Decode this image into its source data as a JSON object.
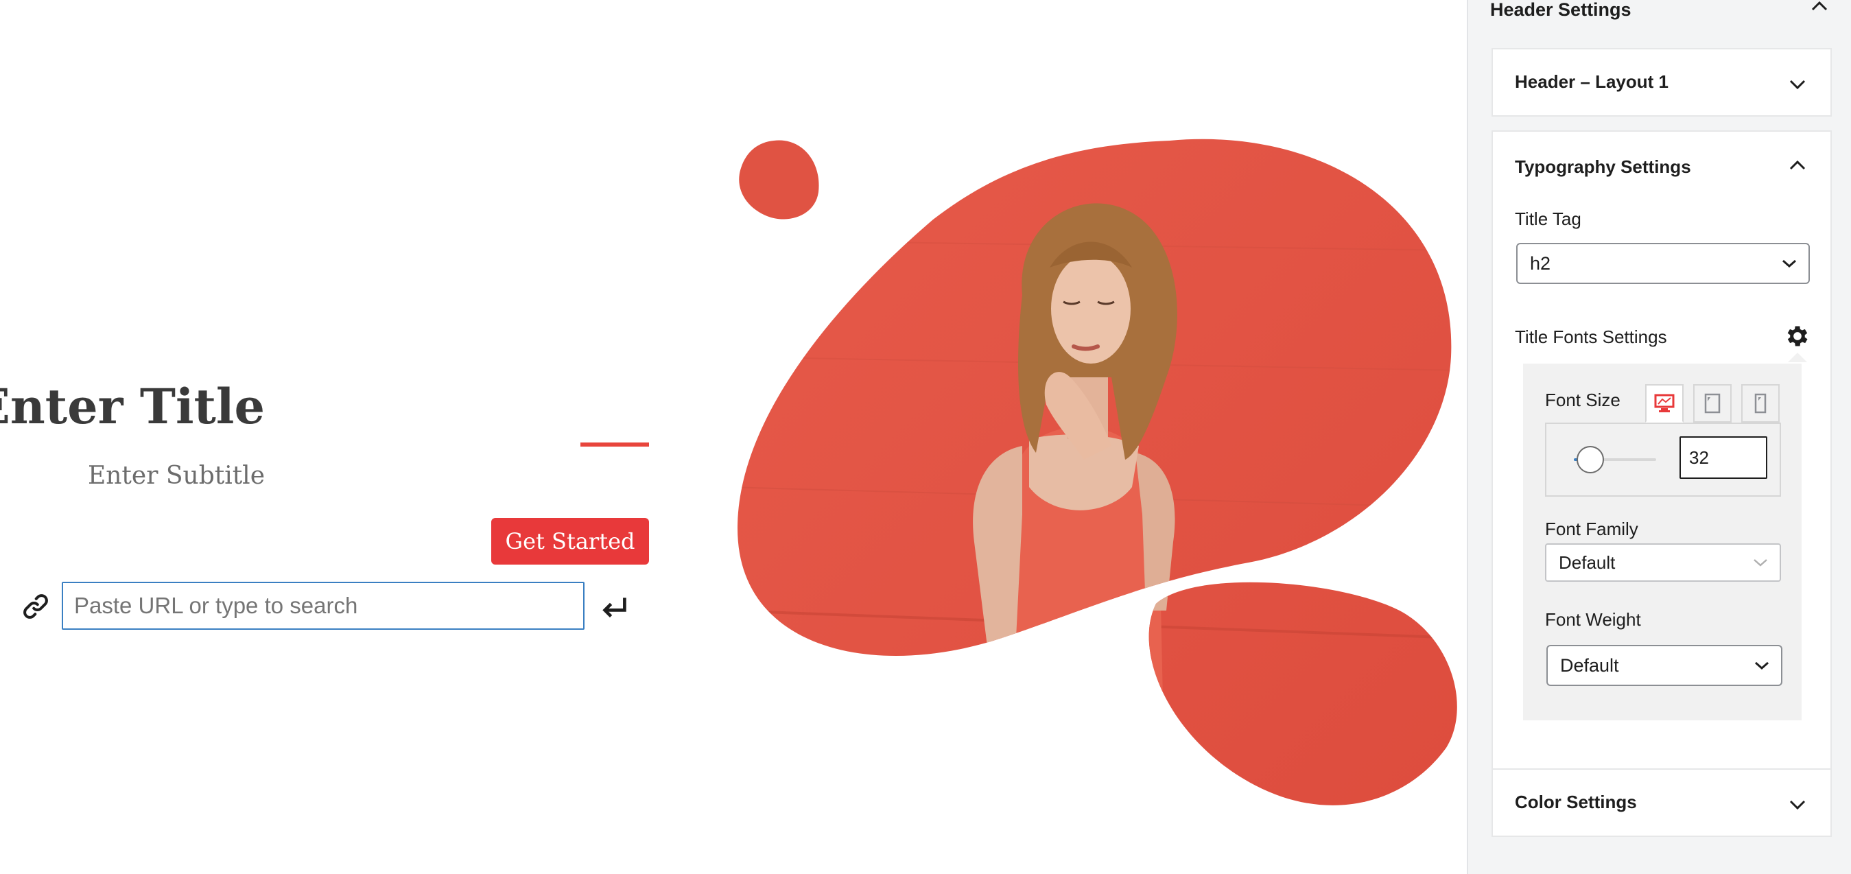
{
  "canvas": {
    "hero": {
      "title": "Enter Title",
      "subtitle": "Enter Subtitle",
      "button_label": "Get Started"
    },
    "link_popover": {
      "placeholder": "Paste URL or type to search",
      "icon": "link-icon",
      "submit_icon": "enter-return-icon"
    },
    "colors": {
      "accent": "#e8453c",
      "button": "#e8393a",
      "blob": "#e05343",
      "title": "#3a3a3a",
      "subtitle": "#6c6c6c",
      "input_focus": "#3a7fc2"
    }
  },
  "sidebar": {
    "panel_title": "Header Settings",
    "sections": {
      "layout": {
        "title": "Header – Layout 1"
      },
      "typography": {
        "title": "Typography Settings",
        "title_tag_label": "Title Tag",
        "title_tag_value": "h2",
        "title_fonts_label": "Title Fonts Settings",
        "font_size_label": "Font Size",
        "devices": [
          "desktop-icon",
          "tablet-icon",
          "mobile-icon"
        ],
        "active_device": "desktop",
        "font_size_value": "32",
        "font_size_fraction": 0.2,
        "font_family_label": "Font Family",
        "font_family_value": "Default",
        "font_weight_label": "Font Weight",
        "font_weight_value": "Default"
      },
      "color": {
        "title": "Color Settings"
      }
    }
  }
}
